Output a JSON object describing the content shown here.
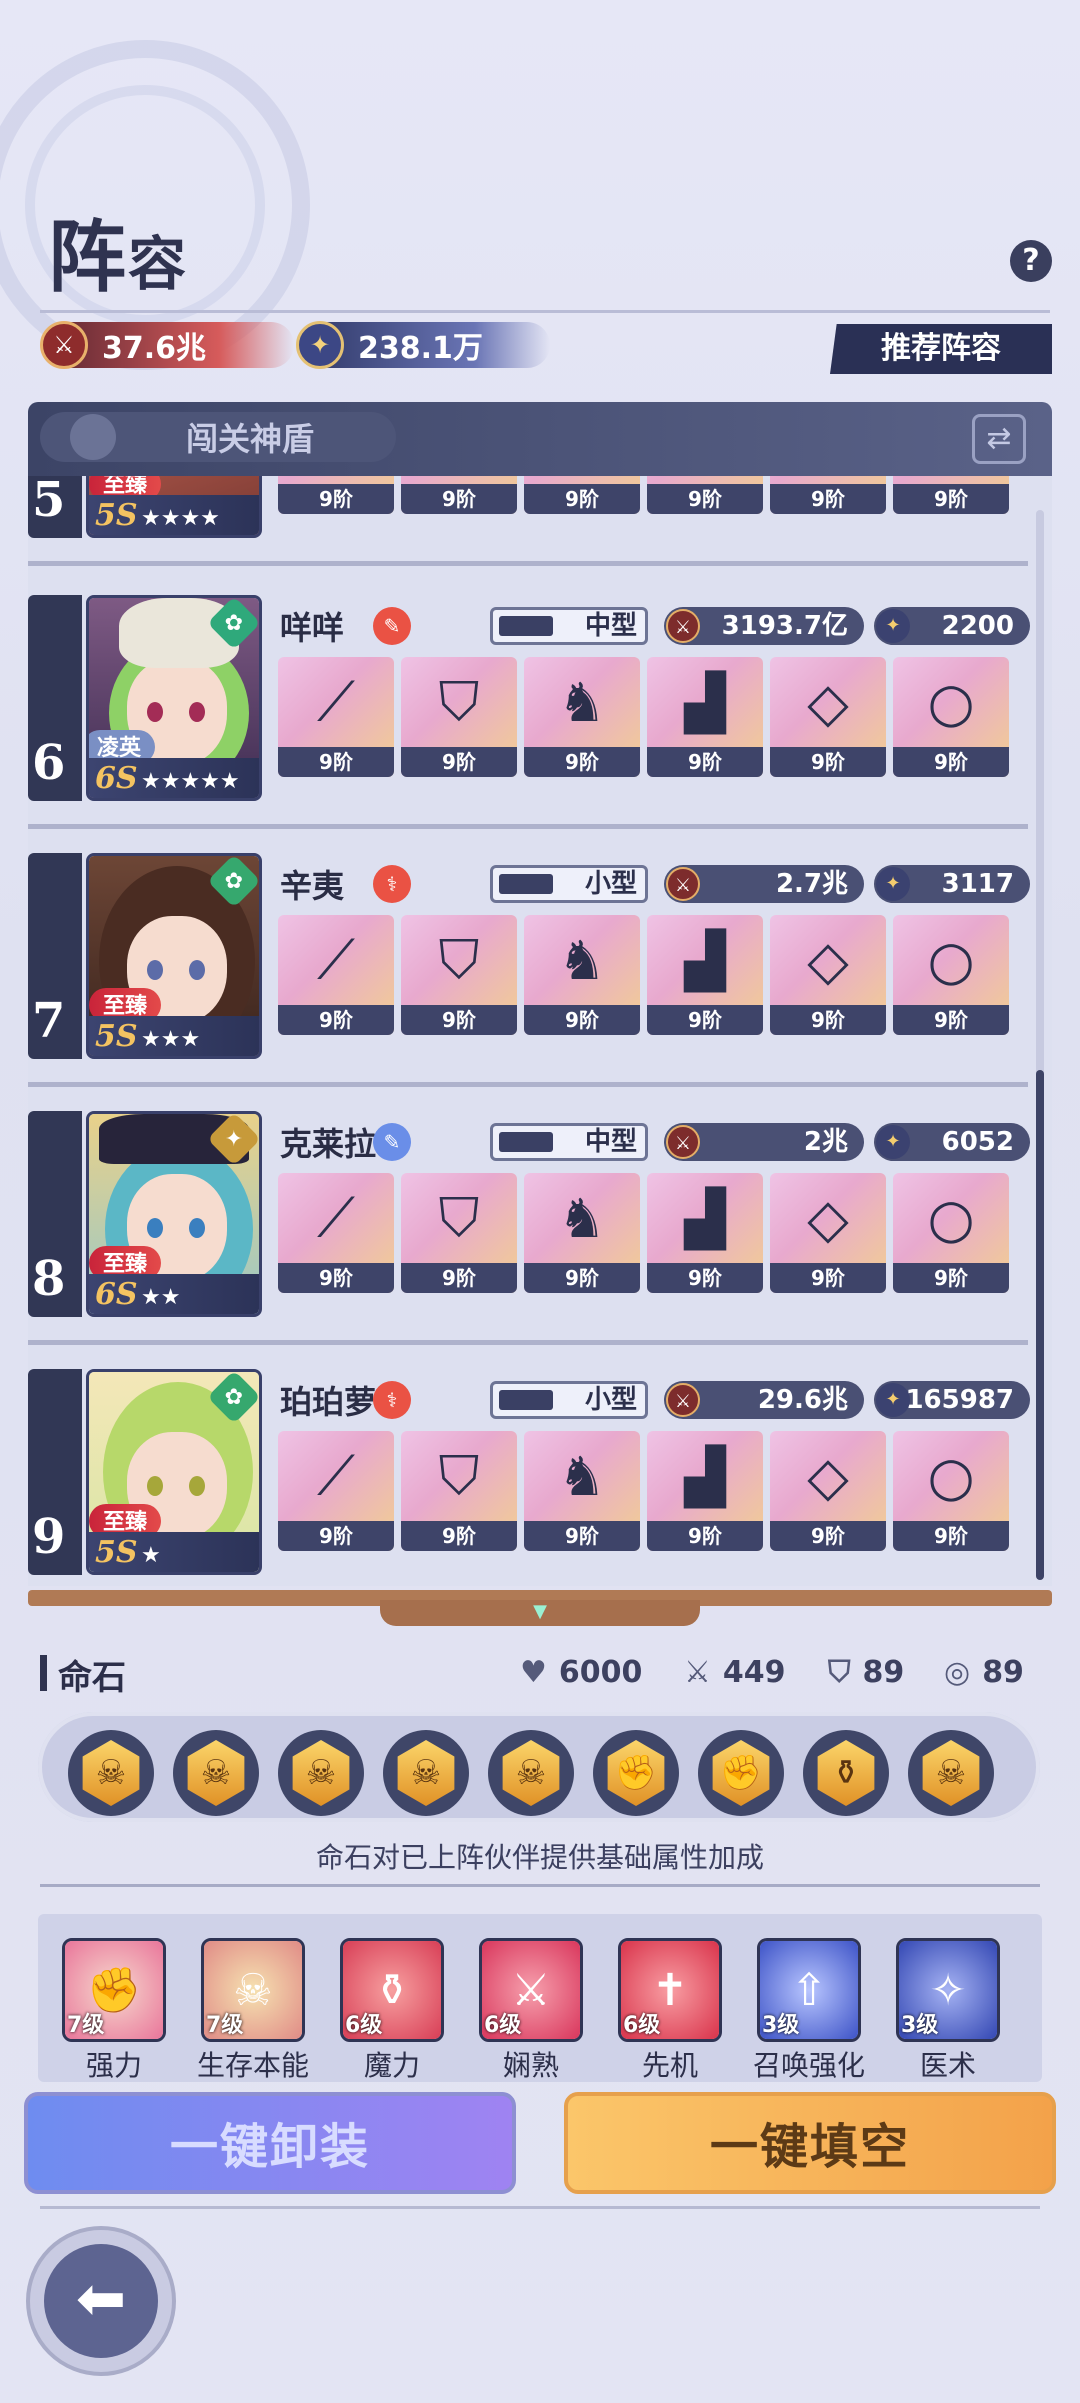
{
  "header": {
    "title_big": "阵",
    "title_small": "容",
    "power": "37.6兆",
    "gold": "238.1万",
    "recommend_label": "推荐阵容",
    "help": "?"
  },
  "team": {
    "name": "闯关神盾",
    "swap_icon": "⇄"
  },
  "heroes": [
    {
      "num": "5",
      "name": "",
      "rank": "5S",
      "stars": "★★★★",
      "tag": "至臻",
      "size": "",
      "power": "",
      "gold": "",
      "gear_level": "9阶"
    },
    {
      "num": "6",
      "name": "咩咩",
      "rank": "6S",
      "stars": "★★★★★",
      "tag": "凌英",
      "size": "中型",
      "power": "3193.7亿",
      "gold": "2200",
      "gear_level": "9阶"
    },
    {
      "num": "7",
      "name": "辛夷",
      "rank": "5S",
      "stars": "★★★",
      "tag": "至臻",
      "size": "小型",
      "power": "2.7兆",
      "gold": "3117",
      "gear_level": "9阶"
    },
    {
      "num": "8",
      "name": "克莱拉",
      "rank": "6S",
      "stars": "★★",
      "tag": "至臻",
      "size": "中型",
      "power": "2兆",
      "gold": "6052",
      "gear_level": "9阶"
    },
    {
      "num": "9",
      "name": "珀珀萝",
      "rank": "5S",
      "stars": "★",
      "tag": "至臻",
      "size": "小型",
      "power": "29.6兆",
      "gold": "165987",
      "gear_level": "9阶"
    }
  ],
  "stones": {
    "title": "命石",
    "stat1": "6000",
    "stat2": "449",
    "stat3": "89",
    "stat4": "89",
    "desc": "命石对已上阵伙伴提供基础属性加成"
  },
  "skills": [
    {
      "name": "强力",
      "level": "7级"
    },
    {
      "name": "生存本能",
      "level": "7级"
    },
    {
      "name": "魔力",
      "level": "6级"
    },
    {
      "name": "娴熟",
      "level": "6级"
    },
    {
      "name": "先机",
      "level": "6级"
    },
    {
      "name": "召唤强化",
      "level": "3级"
    },
    {
      "name": "医术",
      "level": "3级"
    }
  ],
  "buttons": {
    "unequip": "一键卸装",
    "fill": "一键填空"
  },
  "colors": {
    "accent_dark": "#2a3055",
    "fill_button": "#f3a24a",
    "unequip_button": "#7f89f0"
  }
}
